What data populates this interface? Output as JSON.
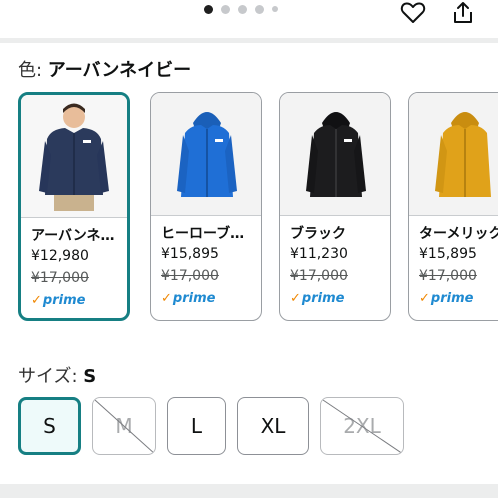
{
  "carousel": {
    "total_dots": 5,
    "active_index": 0
  },
  "actions": {
    "wishlist_icon": "heart-icon",
    "share_icon": "share-icon"
  },
  "color": {
    "prefix": "色: ",
    "selected": "アーバンネイビー",
    "options": [
      {
        "name": "アーバンネ…",
        "price": "¥12,980",
        "list_price": "¥17,000",
        "prime": "prime",
        "image": "person-wearing-navy-jacket",
        "color": "#2b3a5c",
        "selected": true
      },
      {
        "name": "ヒーローブ…",
        "price": "¥15,895",
        "list_price": "¥17,000",
        "prime": "prime",
        "image": "blue-jacket",
        "color": "#1f6fd6",
        "selected": false
      },
      {
        "name": "ブラック",
        "price": "¥11,230",
        "list_price": "¥17,000",
        "prime": "prime",
        "image": "black-jacket",
        "color": "#1c1c1e",
        "selected": false
      },
      {
        "name": "ターメリック",
        "price": "¥15,895",
        "list_price": "¥17,000",
        "prime": "prime",
        "image": "yellow-jacket",
        "color": "#e0a21a",
        "selected": false
      }
    ]
  },
  "size": {
    "prefix": "サイズ: ",
    "selected": "S",
    "options": [
      {
        "label": "S",
        "state": "selected"
      },
      {
        "label": "M",
        "state": "unavailable"
      },
      {
        "label": "L",
        "state": "available"
      },
      {
        "label": "XL",
        "state": "available"
      },
      {
        "label": "2XL",
        "state": "unavailable"
      }
    ]
  },
  "colors": {
    "accent": "#167f83",
    "prime": "#1f8ad1",
    "prime_check": "#f08804"
  }
}
